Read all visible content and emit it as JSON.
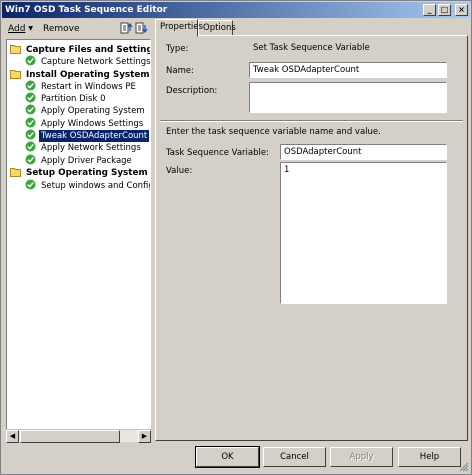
{
  "window": {
    "title": "Win7 OSD Task Sequence Editor"
  },
  "toolbar": {
    "add_label": "Add",
    "remove_label": "Remove"
  },
  "tree": {
    "items": [
      {
        "label": "Capture Files and Settings",
        "type": "group"
      },
      {
        "label": "Capture Network Settings",
        "type": "step"
      },
      {
        "label": "Install Operating System",
        "type": "group"
      },
      {
        "label": "Restart in Windows PE",
        "type": "step"
      },
      {
        "label": "Partition Disk 0",
        "type": "step"
      },
      {
        "label": "Apply Operating System",
        "type": "step"
      },
      {
        "label": "Apply Windows Settings",
        "type": "step"
      },
      {
        "label": "Tweak OSDAdapterCount",
        "type": "step",
        "selected": true
      },
      {
        "label": "Apply Network Settings",
        "type": "step"
      },
      {
        "label": "Apply Driver Package",
        "type": "step"
      },
      {
        "label": "Setup Operating System",
        "type": "group"
      },
      {
        "label": "Setup windows and ConfigMgr",
        "type": "step"
      }
    ]
  },
  "tabs": [
    {
      "label": "Properties"
    },
    {
      "label": "Options"
    }
  ],
  "properties": {
    "type_label": "Type:",
    "type_value": "Set Task Sequence Variable",
    "name_label": "Name:",
    "name_value": "Tweak OSDAdapterCount",
    "description_label": "Description:",
    "description_value": "",
    "instruction": "Enter the task sequence variable name and value.",
    "variable_label": "Task Sequence Variable:",
    "variable_value": "OSDAdapterCount",
    "value_label": "Value:",
    "value_value": "1"
  },
  "buttons": {
    "ok": "OK",
    "cancel": "Cancel",
    "apply": "Apply",
    "help": "Help"
  },
  "colors": {
    "title_start": "#0a246a",
    "title_end": "#a6caf0",
    "selection": "#0a246a",
    "face": "#d4d0c8"
  },
  "icons": {
    "group": "folder-icon",
    "step": "green-check-icon"
  }
}
